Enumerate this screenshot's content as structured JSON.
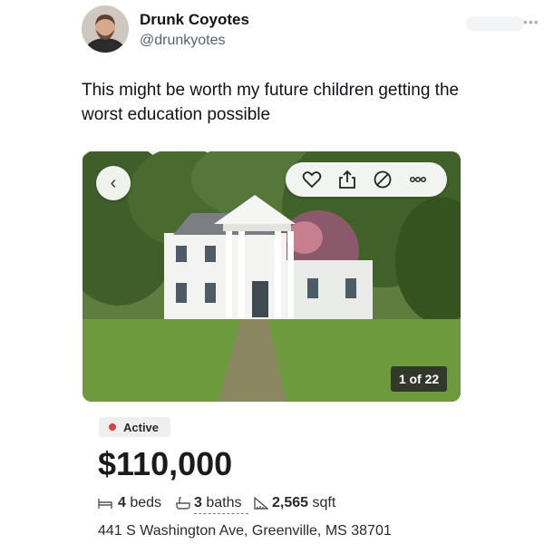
{
  "tweet": {
    "display_name": "Drunk Coyotes",
    "handle": "@drunkyotes",
    "text": "This might be worth my future children getting the worst education possible",
    "avatar_icon": "user-avatar",
    "more_icon": "more-horizontal-icon"
  },
  "listing": {
    "photo_counter": "1 of 22",
    "status": "Active",
    "status_color": "#d9413b",
    "price": "$110,000",
    "beds_value": "4",
    "beds_label": "beds",
    "baths_value": "3",
    "baths_label": "baths",
    "sqft_value": "2,565",
    "sqft_label": "sqft",
    "address": "441 S Washington Ave, Greenville, MS 38701",
    "icons": [
      "chevron-left-icon",
      "heart-icon",
      "share-icon",
      "hide-icon",
      "more-options-icon",
      "bed-icon",
      "bath-icon",
      "ruler-icon"
    ]
  }
}
